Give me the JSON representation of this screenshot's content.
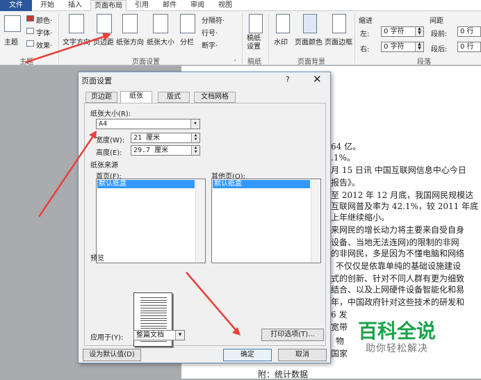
{
  "menu_tabs": [
    "文件",
    "开始",
    "插入",
    "页面布局",
    "引用",
    "邮件",
    "审阅",
    "视图"
  ],
  "active_tab": "页面布局",
  "ribbon": {
    "theme": {
      "label": "主题",
      "colors": "颜色·",
      "fonts": "字体·",
      "effects": "效果·",
      "group": "主题"
    },
    "page_setup": {
      "text_direction": "文字方向",
      "margins": "页边距",
      "orientation": "纸张方向",
      "size": "纸张大小",
      "columns": "分栏",
      "breaks": "分隔符·",
      "line_numbers": "行号·",
      "hyphenation": "断字·",
      "group": "页面设置"
    },
    "manuscript": {
      "label": "稿纸设置",
      "group": "稿纸"
    },
    "background": {
      "watermark": "水印",
      "page_color": "页面颜色",
      "page_borders": "页面边框",
      "group": "页面背景"
    },
    "paragraph": {
      "indent": "缩进",
      "left": "左:",
      "left_val": "0 字符",
      "right": "右:",
      "right_val": "0 字符",
      "spacing": "间距",
      "before": "段前:",
      "before_val": "0 行",
      "after": "段后:",
      "after_val": "0 行",
      "group": "段落"
    }
  },
  "document_lines": [
    "64 亿。",
    ".1%。",
    "月 15 日讯 中国互联网信息中心今日",
    "报告》。",
    "至 2012 年 12 月底，我国网民规模达",
    "互联网普及率为 42.1%，较 2011 年底",
    "上年继续缩小。",
    "来网民的增长动力将主要来自受自身",
    "设备、当地无法连网)的限制的非网",
    "的非网民，多是因为不懂电脑和网络",
    "不仅仅是依靠单纯的基础设施建设",
    "式的创新、针对不同人群有更为细致",
    "结合、以及上网硬件设备智能化和易",
    "年，中国政府针对这些技术的研发和",
    "6 发",
    "宽带",
    "物",
    "国家",
    "附：统计数据"
  ],
  "dialog": {
    "title": "页面设置",
    "help": "?",
    "close": "✕",
    "tabs": [
      "页边距",
      "纸张",
      "版式",
      "文档网格"
    ],
    "active_tab": "纸张",
    "paper_size_label": "纸张大小(R):",
    "paper_size": "A4",
    "width_label": "宽度(W):",
    "width_value": "21 厘米",
    "height_label": "高度(E):",
    "height_value": "29.7 厘米",
    "source_label": "纸张来源",
    "first_page_label": "首页(F):",
    "first_page_item": "默认纸盒",
    "other_pages_label": "其他页(O):",
    "other_pages_item": "默认纸盒",
    "preview_label": "预览",
    "apply_to_label": "应用于(Y):",
    "apply_to_value": "整篇文档",
    "print_options": "打印选项(T)...",
    "set_default": "设为默认值(D)",
    "ok": "确定",
    "cancel": "取消"
  },
  "watermark": {
    "title": "百科全说",
    "subtitle": "助你轻松解决"
  },
  "colors": {
    "accent": "#2b579a",
    "arrow": "#e8403a",
    "watermark_green": "#1aa34a",
    "selection": "#3399ff"
  }
}
